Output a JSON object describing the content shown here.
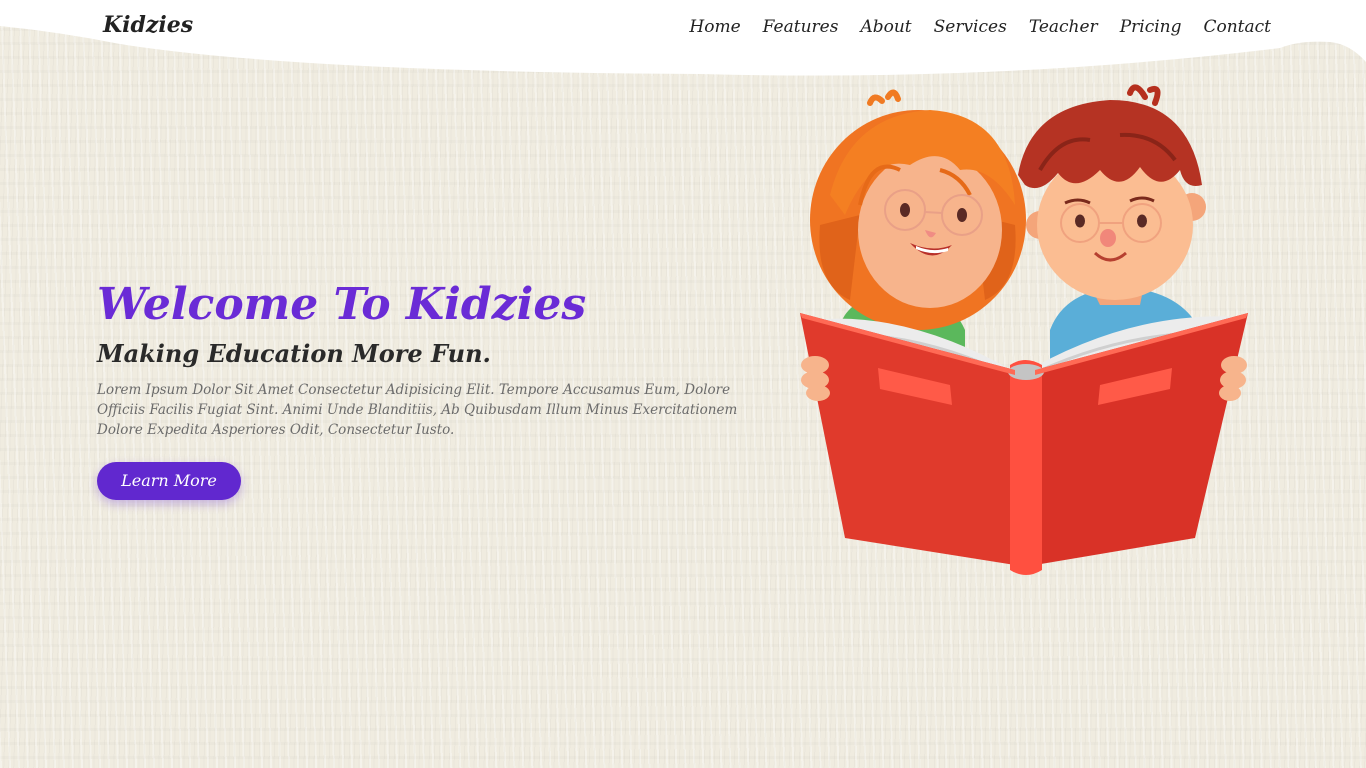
{
  "brand": {
    "name": "Kidzies"
  },
  "nav": {
    "items": [
      {
        "label": "Home"
      },
      {
        "label": "Features"
      },
      {
        "label": "About"
      },
      {
        "label": "Services"
      },
      {
        "label": "Teacher"
      },
      {
        "label": "Pricing"
      },
      {
        "label": "Contact"
      }
    ]
  },
  "hero": {
    "title": "Welcome To Kidzies",
    "subtitle": "Making Education More Fun.",
    "description": "Lorem Ipsum Dolor Sit Amet Consectetur Adipisicing Elit. Tempore Accusamus Eum, Dolore Officiis Facilis Fugiat Sint. Animi Unde Blanditiis, Ab Quibusdam Illum Minus Exercitationem Dolore Expedita Asperiores Odit, Consectetur Iusto.",
    "button_label": "Learn More"
  },
  "colors": {
    "accent": "#6128cf",
    "title": "#6a2bd6",
    "background": "#f0ece0",
    "book": "#e63b30"
  },
  "icons": {
    "illustration": "kids-reading-book-illustration"
  }
}
